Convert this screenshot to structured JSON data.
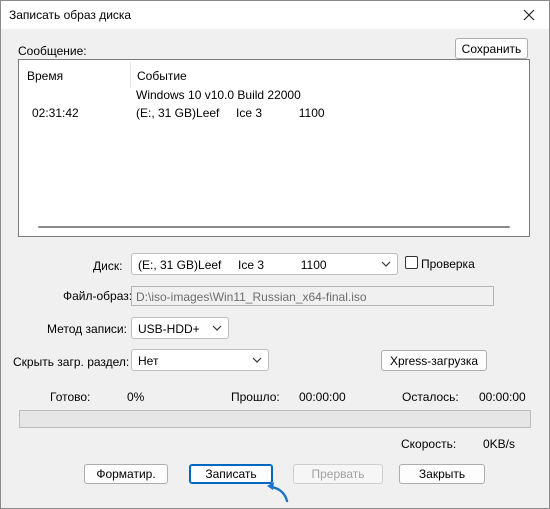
{
  "window": {
    "title": "Записать образ диска"
  },
  "log": {
    "label": "Сообщение:",
    "save_button": "Сохранить",
    "col_time": "Время",
    "col_event": "Событие",
    "rows": [
      {
        "time": "",
        "event": "Windows 10 v10.0 Build 22000"
      },
      {
        "time": "02:31:42",
        "event": "(E:, 31 GB)Leef     Ice 3           1100"
      }
    ]
  },
  "disk": {
    "label": "Диск:",
    "value": "(E:, 31 GB)Leef     Ice 3           1100",
    "verify_label": "Проверка",
    "verify_checked": false
  },
  "image_file": {
    "label": "Файл-образ:",
    "value": "D:\\iso-images\\Win11_Russian_x64-final.iso"
  },
  "write_method": {
    "label": "Метод записи:",
    "value": "USB-HDD+"
  },
  "hide_partition": {
    "label": "Скрыть загр. раздел:",
    "value": "Нет"
  },
  "xpress_button": "Xpress-загрузка",
  "status": {
    "done_label": "Готово:",
    "done_value": "0%",
    "elapsed_label": "Прошло:",
    "elapsed_value": "00:00:00",
    "remaining_label": "Осталось:",
    "remaining_value": "00:00:00",
    "speed_label": "Скорость:",
    "speed_value": "0KB/s",
    "progress_fraction": 0
  },
  "buttons": {
    "format": "Форматир.",
    "write": "Записать",
    "abort": "Прервать",
    "close": "Закрыть"
  },
  "colors": {
    "focus_accent": "#0067c0",
    "cursor_accent": "#1a73c9"
  },
  "icons": {
    "close": "close-icon",
    "dropdown": "chevron-down-icon",
    "cursor": "curved-arrow-cursor-icon"
  }
}
